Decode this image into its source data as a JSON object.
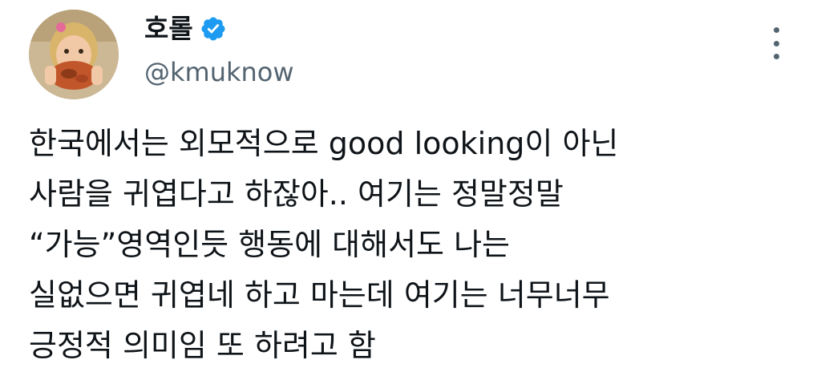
{
  "author": {
    "display_name": "호롤",
    "handle": "@kmuknow",
    "avatar_icon": "avatar-girl-eating-noodles",
    "verified_icon": "verified-badge-icon",
    "verified_color": "#1d9bf0"
  },
  "menu": {
    "icon": "more-vertical-icon"
  },
  "tweet": {
    "lines": [
      "한국에서는 외모적으로 good looking이 아닌",
      "사람을 귀엽다고 하잖아.. 여기는 정말정말",
      "“가능”영역인듯 행동에 대해서도 나는",
      "실없으면 귀엽네 하고 마는데 여기는 너무너무",
      "긍정적 의미임 또 하려고 함"
    ]
  }
}
